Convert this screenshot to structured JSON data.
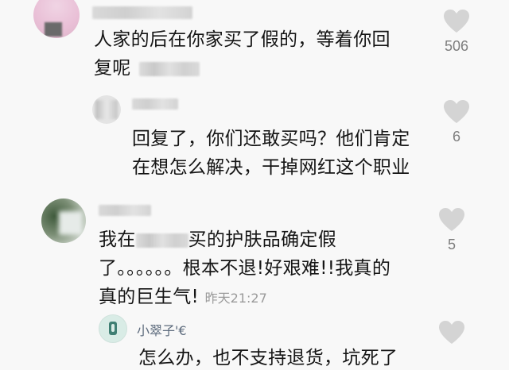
{
  "comments": [
    {
      "text_line1": "人家的后在你家买了假的，等着你回",
      "text_line2": "复呢",
      "likes": "506",
      "heart_icon": "heart-icon"
    },
    {
      "text_line1": "回复了，你们还敢买吗？他们肯定",
      "text_line2": "在想怎么解决，干掉网红这个职业",
      "likes": "6",
      "heart_icon": "heart-icon"
    },
    {
      "text_part1": "我在",
      "text_part2": "买的护肤品确定假",
      "text_line2": "了。。。。。。根本不退!好艰难!!我真的",
      "text_line3": "真的巨生气!",
      "time": "昨天21:27",
      "likes": "5",
      "heart_icon": "heart-icon"
    },
    {
      "username": "小翠子'€",
      "text_line1": "怎么办，也不支持退货，坑死了",
      "heart_icon": "heart-icon"
    }
  ],
  "colors": {
    "background": "#f8f8f8",
    "text": "#151515",
    "username": "#5d6b7d",
    "meta": "#9a9a9a",
    "heart": "#d4d4d4"
  }
}
